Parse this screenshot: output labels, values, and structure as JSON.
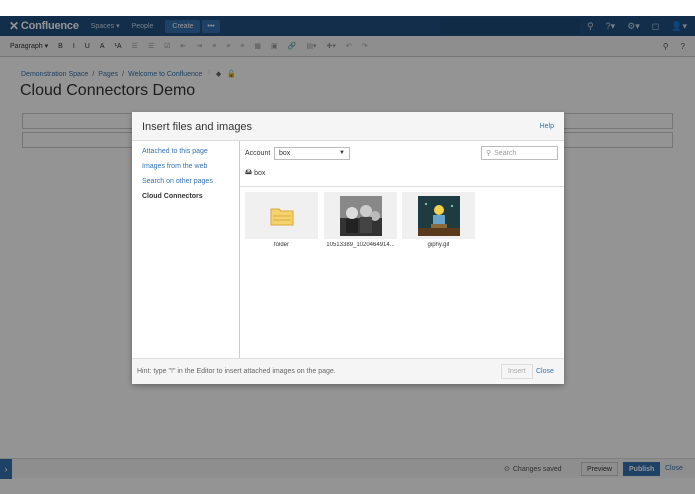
{
  "header": {
    "logo": "Confluence",
    "spaces": "Spaces",
    "people": "People",
    "create": "Create",
    "more": "•••"
  },
  "toolbar": {
    "paragraph": "Paragraph",
    "items": [
      "B",
      "I",
      "U",
      "A",
      "¹A"
    ]
  },
  "breadcrumb": {
    "items": [
      "Demonstration Space",
      "/",
      "Pages",
      "/",
      "Welcome to Confluence"
    ]
  },
  "page": {
    "title": "Cloud Connectors Demo"
  },
  "dialog": {
    "title": "Insert files and images",
    "help": "Help",
    "sidebar": [
      "Attached to this page",
      "Images from the web",
      "Search on other pages",
      "Cloud Connectors"
    ],
    "account_label": "Account",
    "account_value": "box",
    "search_placeholder": "Search",
    "crumb": "box",
    "tiles": [
      {
        "label": "folder"
      },
      {
        "label": "10513389_1020464914..."
      },
      {
        "label": "giphy.gif"
      }
    ],
    "hint": "Hint: type \"!\" in the Editor to insert attached images on the page.",
    "insert": "Insert",
    "close": "Close"
  },
  "bottom": {
    "changes_saved": "Changes saved",
    "preview": "Preview",
    "publish": "Publish",
    "close": "Close"
  },
  "colors": {
    "header": "#205081",
    "link": "#3572b0",
    "overlay": "rgba(0,0,0,0.42)"
  }
}
